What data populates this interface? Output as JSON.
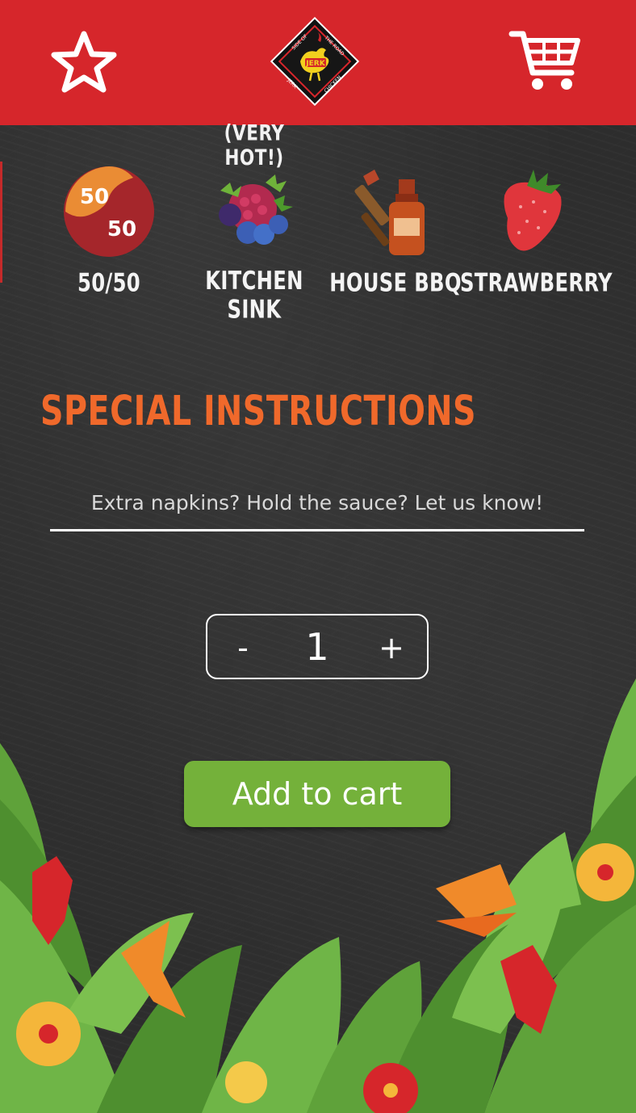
{
  "header": {
    "logo_text": {
      "top": "SIDE OF",
      "top_right": "THE ROAD",
      "center": "JERK",
      "bottom_left": "JERK",
      "bottom_right": "CHICKEN"
    },
    "favorite_icon": "star-outline-icon",
    "cart_icon": "shopping-cart-icon"
  },
  "heat_note": "(VERY HOT!)",
  "flavors": [
    {
      "label": "50/50",
      "icon": "half-half-icon",
      "badge_top": "50",
      "badge_bottom": "50"
    },
    {
      "label": "KITCHEN SINK",
      "icon": "berries-icon"
    },
    {
      "label": "HOUSE BBQ",
      "icon": "bbq-sauce-icon"
    },
    {
      "label": "STRAWBERRY",
      "icon": "strawberry-icon"
    }
  ],
  "special_instructions": {
    "title": "SPECIAL INSTRUCTIONS",
    "placeholder": "Extra napkins? Hold the sauce? Let us know!",
    "value": ""
  },
  "quantity": {
    "minus": "-",
    "value": "1",
    "plus": "+"
  },
  "add_to_cart": "Add to cart",
  "colors": {
    "header": "#d6262b",
    "accent_orange": "#f0692b",
    "button_green": "#74b13a",
    "background": "#2d2d2d"
  }
}
